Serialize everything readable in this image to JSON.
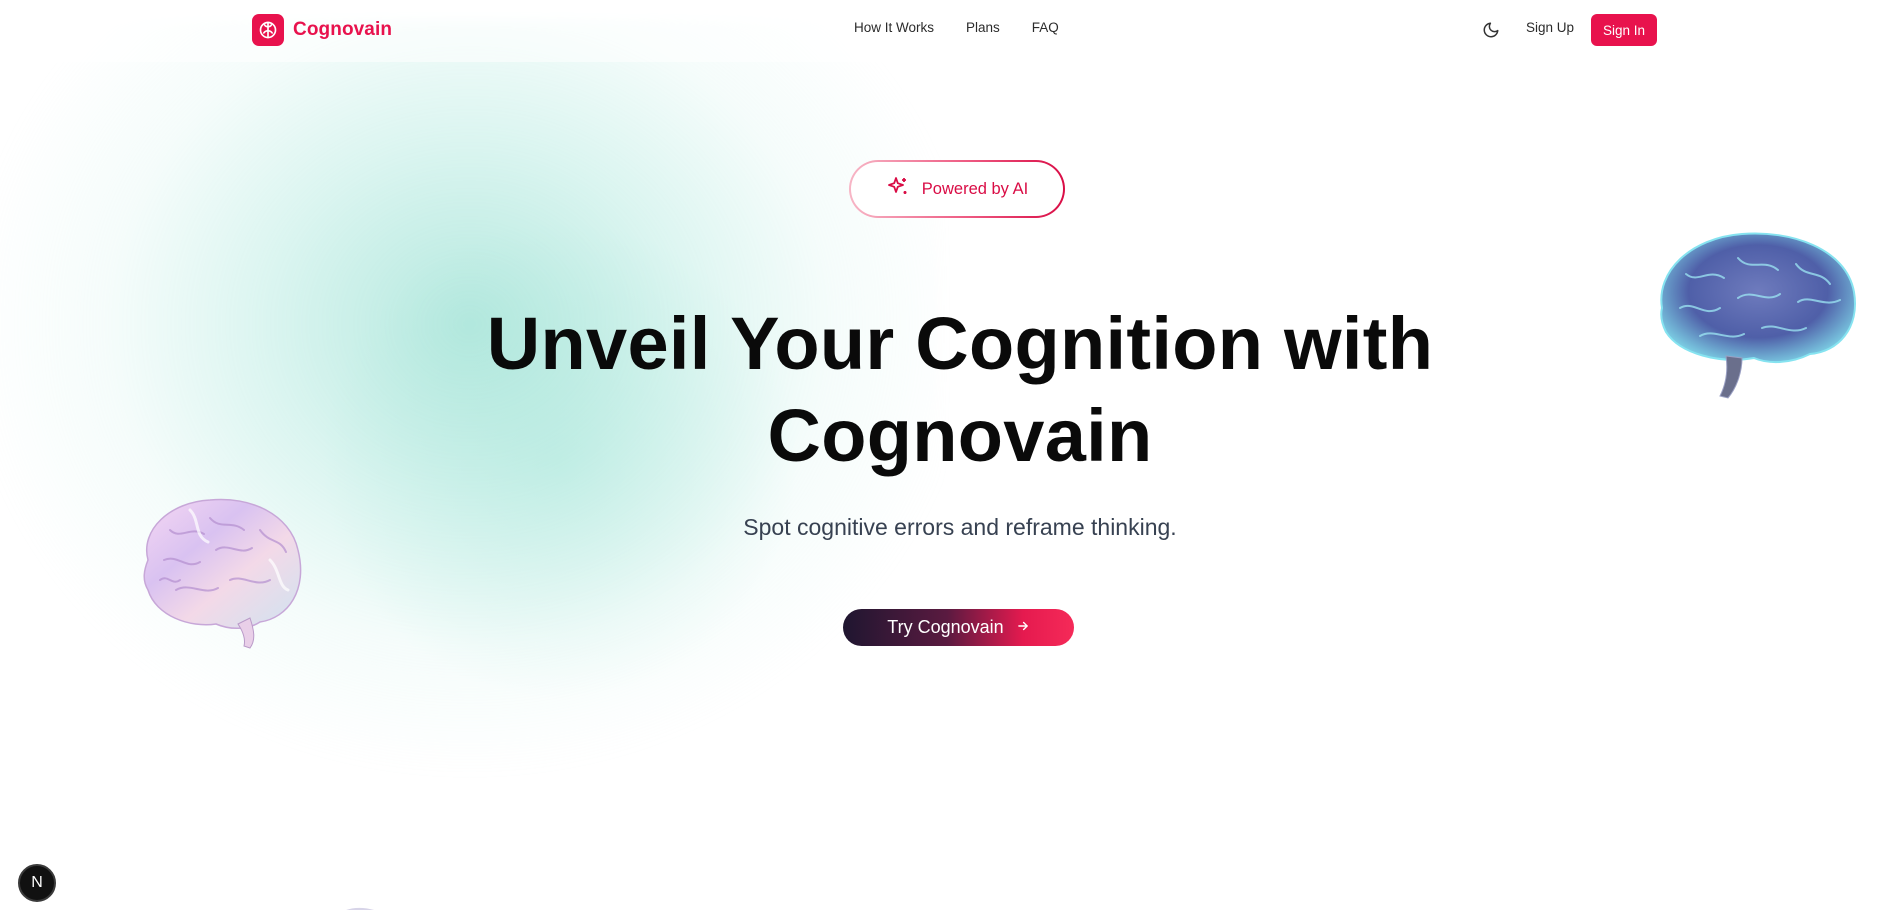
{
  "brand": {
    "name": "Cognovain",
    "logo_icon": "brain-icon",
    "color": "#e8124d"
  },
  "nav": {
    "links": [
      {
        "label": "How It Works"
      },
      {
        "label": "Plans"
      },
      {
        "label": "FAQ"
      }
    ],
    "theme_icon": "moon-icon",
    "sign_up": "Sign Up",
    "sign_in": "Sign In"
  },
  "hero": {
    "badge": {
      "icon": "sparkles-icon",
      "label": "Powered by AI"
    },
    "headline_line1": "Unveil Your Cognition with",
    "headline_line2": "Cognovain",
    "subtitle": "Spot cognitive errors and reframe thinking.",
    "cta": {
      "label": "Try Cognovain",
      "icon": "arrow-right-icon"
    }
  },
  "dev_badge": {
    "label": "N"
  },
  "colors": {
    "accent": "#e8124d",
    "glow": "#78d6c4",
    "cta_dark": "#1f1630"
  }
}
